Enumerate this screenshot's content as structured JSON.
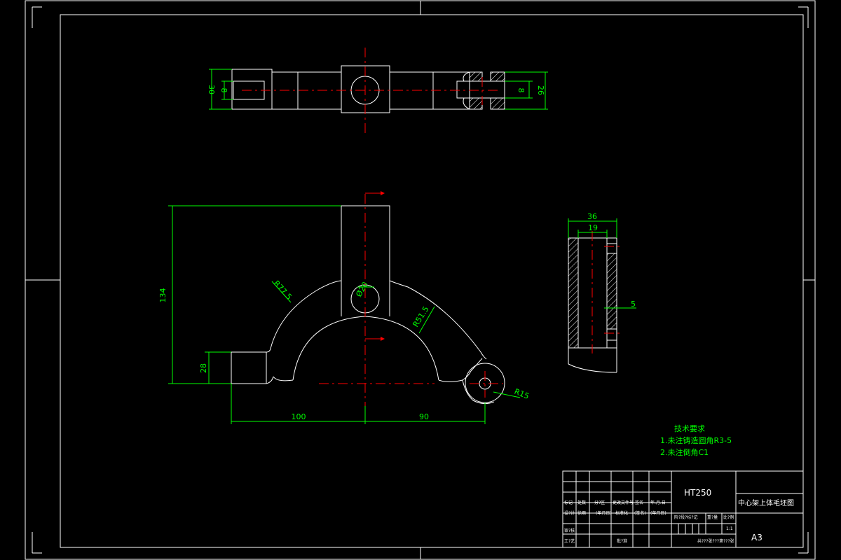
{
  "dimensions": {
    "top_left_height": "30",
    "top_left_inner": "8",
    "top_right_inner": "8",
    "top_right_height": "26",
    "front_height": "134",
    "front_boss_height": "28",
    "front_left_width": "100",
    "front_right_width": "90",
    "radius_outer": "R77.5",
    "radius_inner": "R51.5",
    "radius_end": "R15",
    "hole_dia": "Ø20",
    "side_width": "36",
    "side_inner": "19",
    "side_slot": "5"
  },
  "notes": {
    "heading": "技术要求",
    "line1": "1.未注铸造圆角R3-5",
    "line2": "2.未注倒角C1"
  },
  "title_block": {
    "material": "HT250",
    "part_name": "中心架上体毛坯图",
    "sheet_size": "A3",
    "scale": "1:1",
    "row_labels": [
      "标记",
      "处数",
      "分?区",
      "更改文件号",
      "签名",
      "年.月.日"
    ],
    "design_label": "设?计",
    "design_name": "徐雨",
    "std_label": "标准化",
    "sign_label": "(签名)",
    "date_label": "(年月日)",
    "date_label2": "(年月日)",
    "stage_label": "阶?段?标?记",
    "weight_label": "重?量",
    "scale_label": "比?例",
    "review_label": "审?核",
    "process_label": "工?艺",
    "approve_label": "批?准",
    "sheet_info": "共???张???第???张"
  }
}
